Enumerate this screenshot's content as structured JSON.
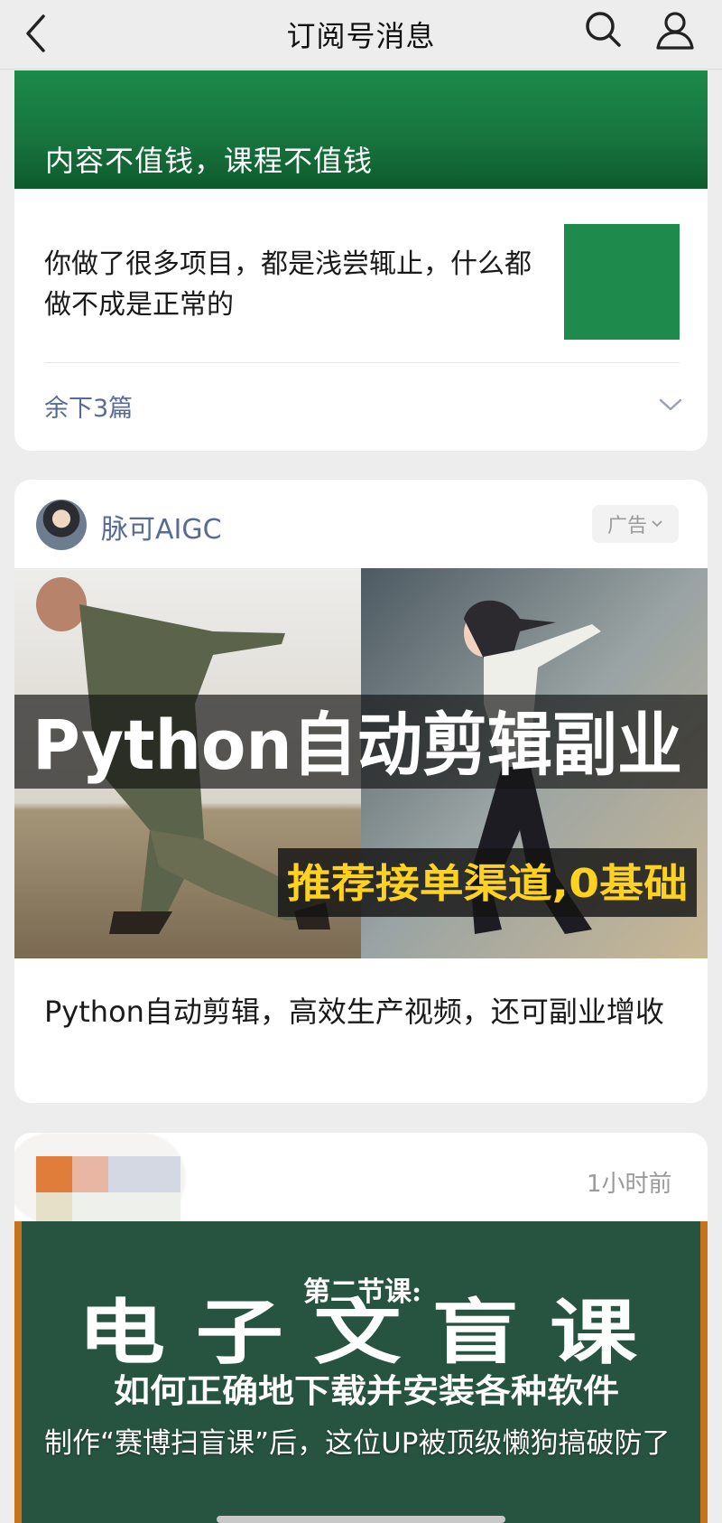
{
  "header": {
    "title": "订阅号消息",
    "back_icon": "chevron-left-icon",
    "search_icon": "search-icon",
    "profile_icon": "user-icon"
  },
  "card_subscription": {
    "banner_title": "内容不值钱，课程不值钱",
    "banner_color": "#17733d",
    "article_title": "你做了很多项目，都是浅尝辄止，什么都做不成是正常的",
    "thumb_color": "#1e8a4c",
    "more_label": "余下3篇"
  },
  "card_ad": {
    "account_name": "脉可AIGC",
    "ad_label": "广告",
    "image_headline": "Python自动剪辑副业",
    "image_subline": "推荐接单渠道,0基础",
    "title": "Python自动剪辑，高效生产视频，还可副业增收"
  },
  "card_recent": {
    "time": "1小时前",
    "board_line1_big": "电 子 文 盲 课",
    "board_line1_small": "第二节课:",
    "board_line2": "如何正确地下载并安装各种软件",
    "caption": "制作“赛博扫盲课”后，这位UP被顶级懒狗搞破防了"
  }
}
